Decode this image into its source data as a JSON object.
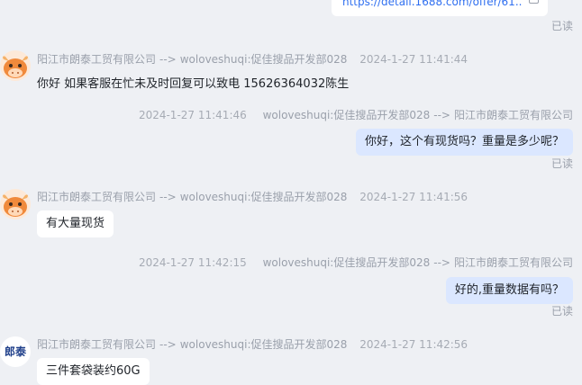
{
  "top_link": {
    "url_text": "https://detail.1688.com/offer/61...",
    "read": "已读"
  },
  "messages": [
    {
      "sender": "阳江市朗泰工贸有限公司",
      "arrow": "-->",
      "receiver": "woloveshuqi:促佳搜品开发部028",
      "time": "2024-1-27 11:41:44",
      "text": "你好 如果客服在忙未及时回复可以致电  15626364032陈生"
    },
    {
      "time": "2024-1-27 11:41:46",
      "sender": "woloveshuqi:促佳搜品开发部028",
      "arrow": "-->",
      "receiver": "阳江市朗泰工贸有限公司",
      "text": "你好，这个有现货吗？重量是多少呢？",
      "read": "已读"
    },
    {
      "sender": "阳江市朗泰工贸有限公司",
      "arrow": "-->",
      "receiver": "woloveshuqi:促佳搜品开发部028",
      "time": "2024-1-27 11:41:56",
      "text": "有大量现货"
    },
    {
      "time": "2024-1-27 11:42:15",
      "sender": "woloveshuqi:促佳搜品开发部028",
      "arrow": "-->",
      "receiver": "阳江市朗泰工贸有限公司",
      "text": "好的,重量数据有吗？",
      "read": "已读"
    },
    {
      "sender": "阳江市朗泰工贸有限公司",
      "arrow": "-->",
      "receiver": "woloveshuqi:促佳搜品开发部028",
      "time": "2024-1-27 11:42:56",
      "text": "三件套袋装约60G",
      "avatar_text": "郎泰"
    }
  ]
}
